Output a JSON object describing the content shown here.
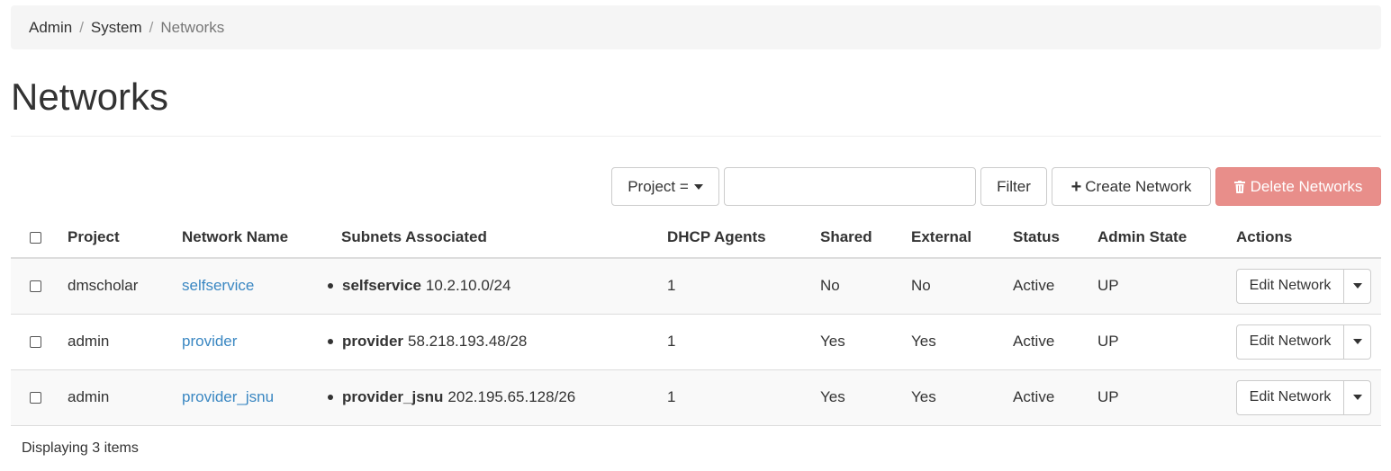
{
  "breadcrumb": {
    "items": [
      "Admin",
      "System"
    ],
    "active": "Networks",
    "separator": "/"
  },
  "page": {
    "title": "Networks"
  },
  "toolbar": {
    "project_select_label": "Project =",
    "filter_input_value": "",
    "filter_label": "Filter",
    "create_label": "Create Network",
    "delete_label": "Delete Networks"
  },
  "table": {
    "headers": [
      "Project",
      "Network Name",
      "Subnets Associated",
      "DHCP Agents",
      "Shared",
      "External",
      "Status",
      "Admin State",
      "Actions"
    ],
    "rows": [
      {
        "project": "dmscholar",
        "network_name": "selfservice",
        "subnet_name": "selfservice",
        "subnet_cidr": "10.2.10.0/24",
        "dhcp_agents": "1",
        "shared": "No",
        "external": "No",
        "status": "Active",
        "admin_state": "UP",
        "action_label": "Edit Network"
      },
      {
        "project": "admin",
        "network_name": "provider",
        "subnet_name": "provider",
        "subnet_cidr": "58.218.193.48/28",
        "dhcp_agents": "1",
        "shared": "Yes",
        "external": "Yes",
        "status": "Active",
        "admin_state": "UP",
        "action_label": "Edit Network"
      },
      {
        "project": "admin",
        "network_name": "provider_jsnu",
        "subnet_name": "provider_jsnu",
        "subnet_cidr": "202.195.65.128/26",
        "dhcp_agents": "1",
        "shared": "Yes",
        "external": "Yes",
        "status": "Active",
        "admin_state": "UP",
        "action_label": "Edit Network"
      }
    ]
  },
  "footer": {
    "count_text": "Displaying 3 items"
  },
  "colors": {
    "link": "#3a87c2",
    "danger": "#e88e8a",
    "breadcrumb_bg": "#f5f5f5",
    "row_stripe": "#f9f9f9"
  },
  "icons": {
    "plus": "plus-icon",
    "trash": "trash-icon",
    "caret": "caret-down-icon",
    "checkbox": "checkbox-icon"
  }
}
